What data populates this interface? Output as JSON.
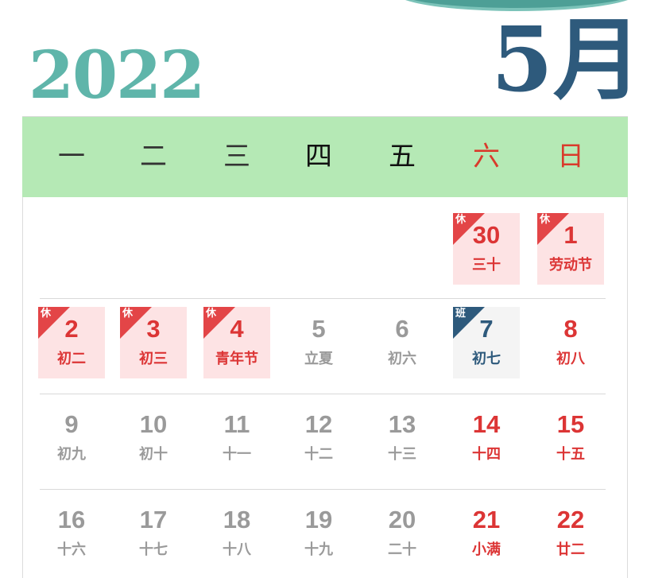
{
  "year": "2022",
  "month": "5月",
  "weekdays": [
    {
      "label": "一",
      "color": "#333333"
    },
    {
      "label": "二",
      "color": "#333333"
    },
    {
      "label": "三",
      "color": "#333333"
    },
    {
      "label": "四",
      "color": "#111111"
    },
    {
      "label": "五",
      "color": "#111111"
    },
    {
      "label": "六",
      "color": "#d93a2b"
    },
    {
      "label": "日",
      "color": "#d93a2b"
    }
  ],
  "rows": [
    [
      null,
      null,
      null,
      null,
      null,
      {
        "day": "30",
        "sub": "三十",
        "tone": "red",
        "bg": "hol",
        "tag": "休"
      },
      {
        "day": "1",
        "sub": "劳动节",
        "tone": "red",
        "bg": "hol",
        "tag": "休"
      }
    ],
    [
      {
        "day": "2",
        "sub": "初二",
        "tone": "red",
        "bg": "hol",
        "tag": "休"
      },
      {
        "day": "3",
        "sub": "初三",
        "tone": "red",
        "bg": "hol",
        "tag": "休"
      },
      {
        "day": "4",
        "sub": "青年节",
        "tone": "red",
        "bg": "hol",
        "tag": "休"
      },
      {
        "day": "5",
        "sub": "立夏",
        "tone": "gray"
      },
      {
        "day": "6",
        "sub": "初六",
        "tone": "gray"
      },
      {
        "day": "7",
        "sub": "初七",
        "tone": "navy",
        "bg": "work",
        "tag": "班"
      },
      {
        "day": "8",
        "sub": "初八",
        "tone": "red"
      }
    ],
    [
      {
        "day": "9",
        "sub": "初九",
        "tone": "gray"
      },
      {
        "day": "10",
        "sub": "初十",
        "tone": "gray"
      },
      {
        "day": "11",
        "sub": "十一",
        "tone": "gray"
      },
      {
        "day": "12",
        "sub": "十二",
        "tone": "gray"
      },
      {
        "day": "13",
        "sub": "十三",
        "tone": "gray"
      },
      {
        "day": "14",
        "sub": "十四",
        "tone": "red"
      },
      {
        "day": "15",
        "sub": "十五",
        "tone": "red"
      }
    ],
    [
      {
        "day": "16",
        "sub": "十六",
        "tone": "gray"
      },
      {
        "day": "17",
        "sub": "十七",
        "tone": "gray"
      },
      {
        "day": "18",
        "sub": "十八",
        "tone": "gray"
      },
      {
        "day": "19",
        "sub": "十九",
        "tone": "gray"
      },
      {
        "day": "20",
        "sub": "二十",
        "tone": "gray"
      },
      {
        "day": "21",
        "sub": "小满",
        "tone": "red"
      },
      {
        "day": "22",
        "sub": "廿二",
        "tone": "red"
      }
    ]
  ]
}
